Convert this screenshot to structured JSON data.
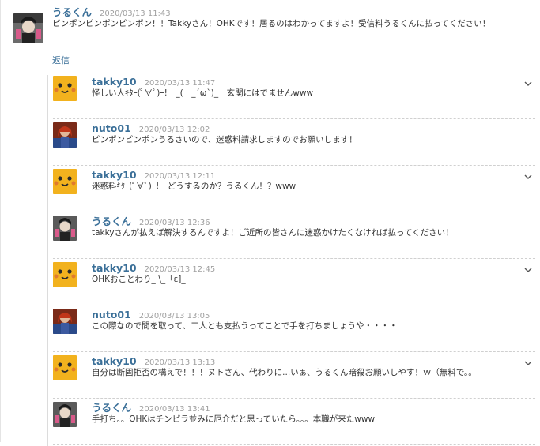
{
  "parent": {
    "author": "うるくん",
    "date": "2020/03/13 11:43",
    "text": "ピンポンピンポンピンポン！！Takkyさん！OHKです！居るのはわかってますよ！受信料うるくんに払ってください！",
    "reply_label": "返信"
  },
  "replies": [
    {
      "author": "takky10",
      "date": "2020/03/13 11:47",
      "text": "怪しい人ｷﾀｰ(ﾟ∀ﾟ)ｰ!　_(　_´ω`)_　玄関にはでませんwww",
      "avatar": "yellow",
      "menu": true
    },
    {
      "author": "nuto01",
      "date": "2020/03/13 12:02",
      "text": "ピンポンピンポンうるさいので、迷惑料請求しますのでお願いします！",
      "avatar": "red",
      "menu": false
    },
    {
      "author": "takky10",
      "date": "2020/03/13 12:11",
      "text": "迷惑料ｷﾀｰ(ﾟ∀ﾟ)ｰ!　どうするのか？うるくん！？www",
      "avatar": "yellow",
      "menu": true
    },
    {
      "author": "うるくん",
      "date": "2020/03/13 12:36",
      "text": "takkyさんが払えば解決するんですよ！ご近所の皆さんに迷惑かけたくなければ払ってください！",
      "avatar": "dark",
      "menu": false
    },
    {
      "author": "takky10",
      "date": "2020/03/13 12:45",
      "text": "OHKおことわり_|\\_「ε]_",
      "avatar": "yellow",
      "menu": true
    },
    {
      "author": "nuto01",
      "date": "2020/03/13 13:05",
      "text": "この際なので間を取って、二人とも支払うってことで手を打ちましょうや・・・・",
      "avatar": "red",
      "menu": false
    },
    {
      "author": "takky10",
      "date": "2020/03/13 13:13",
      "text": "自分は断固拒否の構えで！！！ヌトさん、代わりに...いぁ、うるくん暗殺お願いしやす！ｗ（無料で。。",
      "avatar": "yellow",
      "menu": true
    },
    {
      "author": "うるくん",
      "date": "2020/03/13 13:41",
      "text": "手打ち。。OHKはチンピラ並みに厄介だと思っていたら。。。本職が来たwww",
      "avatar": "dark",
      "menu": false
    }
  ]
}
